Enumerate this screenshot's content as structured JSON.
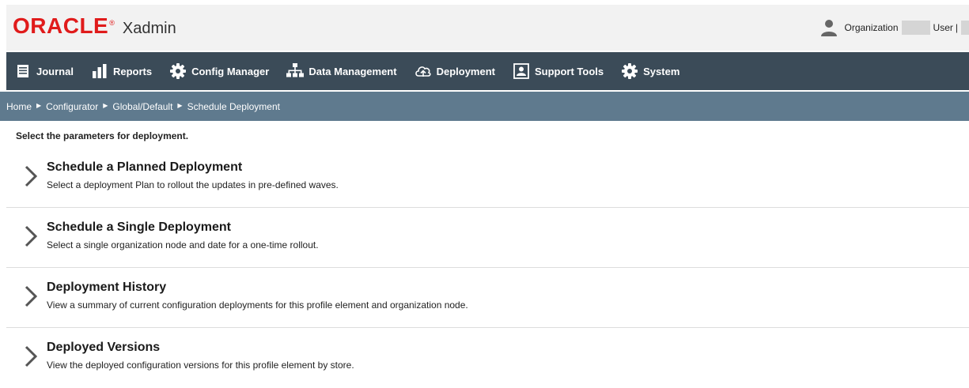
{
  "header": {
    "logo_text": "ORACLE",
    "logo_reg": "®",
    "app_name": "Xadmin",
    "organization_label": "Organization",
    "user_label": "User",
    "separator": "|"
  },
  "nav": {
    "items": [
      {
        "label": "Journal",
        "icon": "journal-icon"
      },
      {
        "label": "Reports",
        "icon": "reports-bar-chart-icon"
      },
      {
        "label": "Config Manager",
        "icon": "gear-icon"
      },
      {
        "label": "Data Management",
        "icon": "hierarchy-icon"
      },
      {
        "label": "Deployment",
        "icon": "cloud-upload-icon"
      },
      {
        "label": "Support Tools",
        "icon": "support-person-icon"
      },
      {
        "label": "System",
        "icon": "gear-icon"
      }
    ]
  },
  "breadcrumb": {
    "items": [
      "Home",
      "Configurator",
      "Global/Default",
      "Schedule Deployment"
    ],
    "separator": "▶"
  },
  "main": {
    "intro": "Select the parameters for deployment.",
    "options": [
      {
        "title": "Schedule a Planned Deployment",
        "description": "Select a deployment Plan to rollout the updates in pre-defined waves."
      },
      {
        "title": "Schedule a Single Deployment",
        "description": "Select a single organization node and date for a one-time rollout."
      },
      {
        "title": "Deployment History",
        "description": "View a summary of current configuration deployments for this profile element and organization node."
      },
      {
        "title": "Deployed Versions",
        "description": "View the deployed configuration versions for this profile element by store."
      }
    ]
  },
  "colors": {
    "brand_red": "#e01b1b",
    "nav_bg": "#3b4b58",
    "breadcrumb_bg": "#5f7a8e"
  }
}
